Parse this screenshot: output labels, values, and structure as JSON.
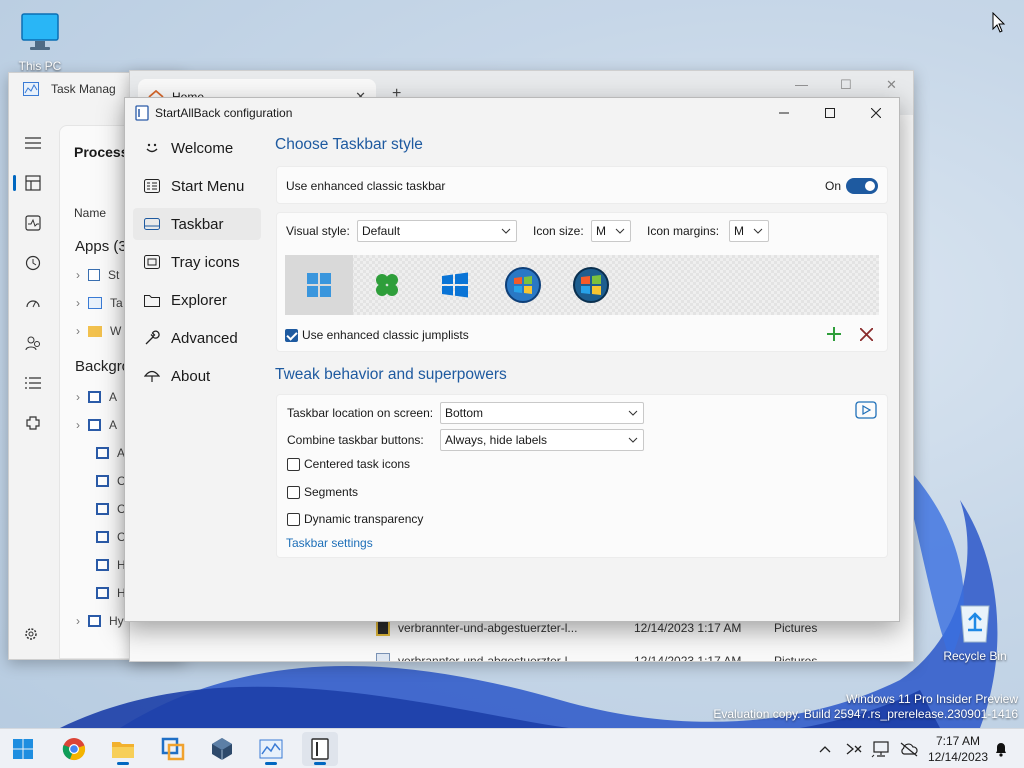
{
  "desktop": {
    "this_pc_label": "This PC",
    "recycle_bin_label": "Recycle Bin",
    "watermark_line1": "Windows 11 Pro Insider Preview",
    "watermark_line2": "Evaluation copy. Build 25947.rs_prerelease.230901-1416"
  },
  "task_manager": {
    "title": "Task Manag",
    "section_title": "Processe",
    "column_name": "Name",
    "apps_group": "Apps (3",
    "background_group": "Backgro",
    "app_rows": [
      "St",
      "Ta",
      "W"
    ],
    "bg_rows": [
      "A",
      "A",
      "A",
      "C",
      "C",
      "C",
      "H",
      "H",
      "Hy"
    ]
  },
  "explorer": {
    "tab_label": "Home",
    "rows": [
      {
        "name": "verbrannter-und-abgestuerzter-l...",
        "date": "12/14/2023 1:17 AM",
        "type": "Pictures"
      },
      {
        "name": "verbrannter-und-abgestuerzter-l...",
        "date": "12/14/2023 1:17 AM",
        "type": "Pictures"
      }
    ]
  },
  "sab": {
    "window_title": "StartAllBack configuration",
    "nav": [
      {
        "label": "Welcome",
        "icon": "smile-icon"
      },
      {
        "label": "Start Menu",
        "icon": "start-menu-icon"
      },
      {
        "label": "Taskbar",
        "icon": "taskbar-icon"
      },
      {
        "label": "Tray icons",
        "icon": "tray-icon"
      },
      {
        "label": "Explorer",
        "icon": "folder-icon"
      },
      {
        "label": "Advanced",
        "icon": "wrench-icon"
      },
      {
        "label": "About",
        "icon": "umbrella-icon"
      }
    ],
    "active_nav": "Taskbar",
    "section1_title": "Choose Taskbar style",
    "enhanced_label": "Use enhanced classic taskbar",
    "toggle_state": "On",
    "visual_style_label": "Visual style:",
    "visual_style_value": "Default",
    "icon_size_label": "Icon size:",
    "icon_size_value": "M",
    "icon_margins_label": "Icon margins:",
    "icon_margins_value": "M",
    "styles": [
      "windows-11-logo-icon",
      "clover-logo-icon",
      "windows-10-logo-icon",
      "windows-7-orb-icon",
      "windows-vista-orb-icon"
    ],
    "jumplists_label": "Use enhanced classic jumplists",
    "jumplists_checked": true,
    "section2_title": "Tweak behavior and superpowers",
    "location_label": "Taskbar location on screen:",
    "location_value": "Bottom",
    "combine_label": "Combine taskbar buttons:",
    "combine_value": "Always, hide labels",
    "centered_label": "Centered task icons",
    "segments_label": "Segments",
    "dynamic_label": "Dynamic transparency",
    "settings_link": "Taskbar settings"
  },
  "taskbar": {
    "apps": [
      "start-icon",
      "chrome-icon",
      "file-explorer-icon",
      "virtualbox-icon",
      "vmware-icon",
      "task-manager-icon",
      "startallback-icon"
    ],
    "time": "7:17 AM",
    "date": "12/14/2023"
  },
  "colors": {
    "accent": "#1e5aa0",
    "link": "#1e6fb8",
    "add": "#2e9e3a",
    "remove": "#b03a3a"
  }
}
